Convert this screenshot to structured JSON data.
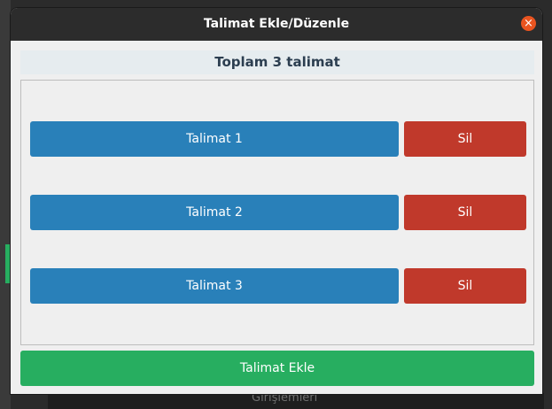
{
  "background": {
    "bottom_text": "Girişlemleri"
  },
  "dialog": {
    "title": "Talimat Ekle/Düzenle",
    "close_icon": "close-icon",
    "summary": "Toplam 3 talimat",
    "items": [
      {
        "label": "Talimat 1",
        "delete_label": "Sil"
      },
      {
        "label": "Talimat 2",
        "delete_label": "Sil"
      },
      {
        "label": "Talimat 3",
        "delete_label": "Sil"
      }
    ],
    "add_label": "Talimat Ekle"
  },
  "colors": {
    "item": "#2980b9",
    "delete": "#c0392b",
    "add": "#27ae60",
    "close": "#e95420",
    "titlebar": "#2c2c2c"
  }
}
